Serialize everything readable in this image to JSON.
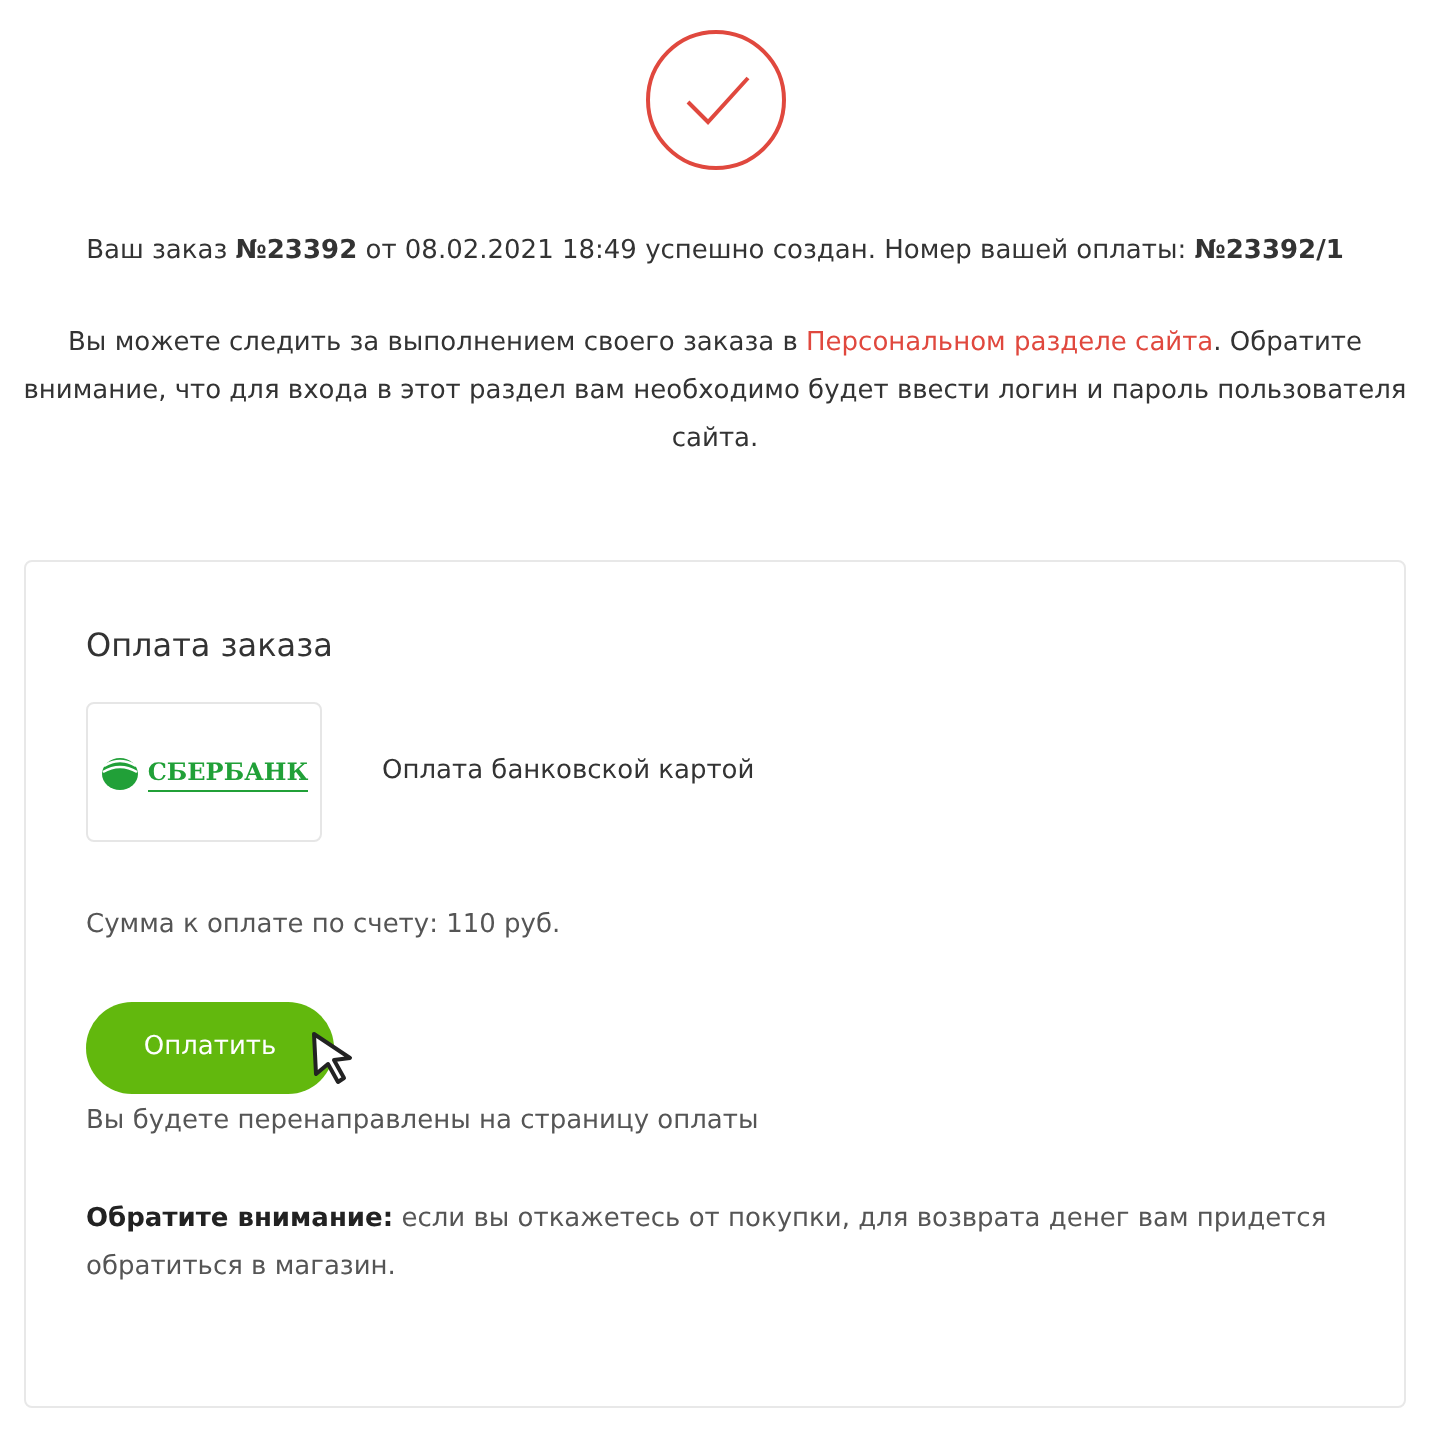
{
  "order_message": "Ваш заказ **№23392** от 08.02.2021 18:49 успешно создан. Номер вашей оплаты: **№23392/1**",
  "info": {
    "before": "Вы можете следить за выполнением своего заказа в",
    "link": "Персональном разделе сайта",
    "after": ". Обратите внимание, что для входа в этот раздел вам необходимо будет ввести логин и пароль пользователя сайта."
  },
  "payment": {
    "title": "Оплата заказа",
    "logo_text": "СБЕРБАНК",
    "method": "Оплата банковской картой",
    "amount": "Сумма к оплате по счету: 110 руб.",
    "button": "Оплатить",
    "redirect_note": "Вы будете перенаправлены на страницу оплаты",
    "notice": "**Обратите внимание:** если вы откажетесь от покупки, для возврата денег вам придется обратиться в магазин."
  }
}
